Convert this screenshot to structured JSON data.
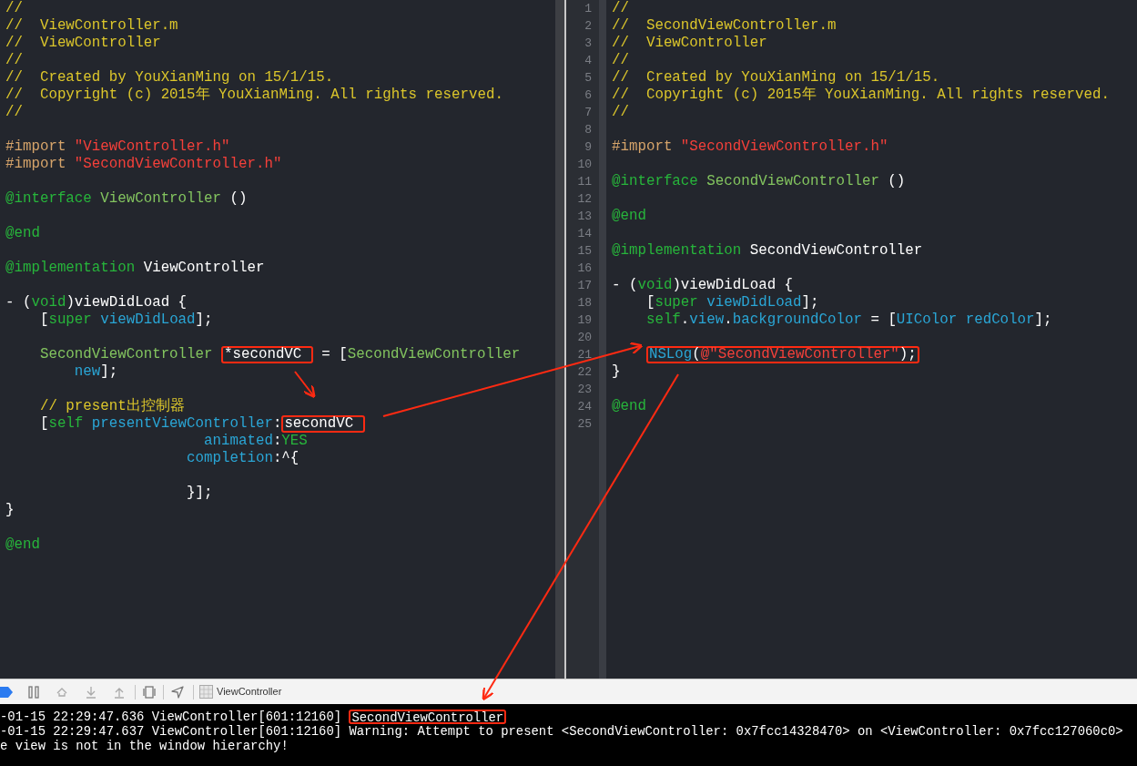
{
  "left_editor": {
    "lines": [
      {
        "kind": "code",
        "tokens": [
          {
            "kind": "comment",
            "text": "//"
          }
        ]
      },
      {
        "kind": "code",
        "tokens": [
          {
            "kind": "comment",
            "text": "//  ViewController.m"
          }
        ]
      },
      {
        "kind": "code",
        "tokens": [
          {
            "kind": "comment",
            "text": "//  ViewController"
          }
        ]
      },
      {
        "kind": "code",
        "tokens": [
          {
            "kind": "comment",
            "text": "//"
          }
        ]
      },
      {
        "kind": "code",
        "tokens": [
          {
            "kind": "comment",
            "text": "//  Created by YouXianMing on 15/1/15."
          }
        ]
      },
      {
        "kind": "code",
        "tokens": [
          {
            "kind": "comment",
            "text": "//  Copyright (c) 2015年 YouXianMing. All rights reserved."
          }
        ]
      },
      {
        "kind": "code",
        "tokens": [
          {
            "kind": "comment",
            "text": "//"
          }
        ]
      },
      {
        "kind": "blank"
      },
      {
        "kind": "code",
        "tokens": [
          {
            "kind": "preproc",
            "text": "#import "
          },
          {
            "kind": "string",
            "text": "\"ViewController.h\""
          }
        ]
      },
      {
        "kind": "code",
        "tokens": [
          {
            "kind": "preproc",
            "text": "#import "
          },
          {
            "kind": "string",
            "text": "\"SecondViewController.h\""
          }
        ]
      },
      {
        "kind": "blank"
      },
      {
        "kind": "code",
        "tokens": [
          {
            "kind": "keyword",
            "text": "@interface "
          },
          {
            "kind": "class",
            "text": "ViewController"
          },
          {
            "kind": "plain",
            "text": " ()"
          }
        ]
      },
      {
        "kind": "blank"
      },
      {
        "kind": "code",
        "tokens": [
          {
            "kind": "keyword",
            "text": "@end"
          }
        ]
      },
      {
        "kind": "blank"
      },
      {
        "kind": "code",
        "tokens": [
          {
            "kind": "keyword",
            "text": "@implementation "
          },
          {
            "kind": "plain",
            "text": "ViewController"
          }
        ]
      },
      {
        "kind": "blank"
      },
      {
        "kind": "code",
        "tokens": [
          {
            "kind": "plain",
            "text": "- ("
          },
          {
            "kind": "keyword",
            "text": "void"
          },
          {
            "kind": "plain",
            "text": ")viewDidLoad {"
          }
        ]
      },
      {
        "kind": "code",
        "tokens": [
          {
            "kind": "plain",
            "text": "    ["
          },
          {
            "kind": "keyword",
            "text": "super"
          },
          {
            "kind": "method",
            "text": " viewDidLoad"
          },
          {
            "kind": "plain",
            "text": "];"
          }
        ]
      },
      {
        "kind": "blank"
      },
      {
        "kind": "code",
        "tokens": [
          {
            "kind": "class",
            "text": "    SecondViewController "
          },
          {
            "kind": "boxed",
            "tokens": [
              {
                "kind": "plain",
                "text": "*secondVC "
              }
            ]
          },
          {
            "kind": "plain",
            "text": " = ["
          },
          {
            "kind": "class",
            "text": "SecondViewController"
          }
        ]
      },
      {
        "kind": "code",
        "tokens": [
          {
            "kind": "method",
            "text": "        new"
          },
          {
            "kind": "plain",
            "text": "];"
          }
        ]
      },
      {
        "kind": "blank"
      },
      {
        "kind": "code",
        "tokens": [
          {
            "kind": "comment",
            "text": "    // present出控制器"
          }
        ]
      },
      {
        "kind": "code",
        "tokens": [
          {
            "kind": "plain",
            "text": "    ["
          },
          {
            "kind": "keyword",
            "text": "self"
          },
          {
            "kind": "method",
            "text": " presentViewController"
          },
          {
            "kind": "plain",
            "text": ":"
          },
          {
            "kind": "boxed",
            "tokens": [
              {
                "kind": "plain",
                "text": "secondVC "
              }
            ]
          }
        ]
      },
      {
        "kind": "code",
        "tokens": [
          {
            "kind": "method",
            "text": "                       animated"
          },
          {
            "kind": "plain",
            "text": ":"
          },
          {
            "kind": "keyword",
            "text": "YES"
          }
        ]
      },
      {
        "kind": "code",
        "tokens": [
          {
            "kind": "method",
            "text": "                     completion"
          },
          {
            "kind": "plain",
            "text": ":^{"
          }
        ]
      },
      {
        "kind": "blank"
      },
      {
        "kind": "code",
        "tokens": [
          {
            "kind": "plain",
            "text": "                     }];"
          }
        ]
      },
      {
        "kind": "code",
        "tokens": [
          {
            "kind": "plain",
            "text": "}"
          }
        ]
      },
      {
        "kind": "blank"
      },
      {
        "kind": "code",
        "tokens": [
          {
            "kind": "keyword",
            "text": "@end"
          }
        ]
      }
    ]
  },
  "right_editor": {
    "lines": [
      {
        "number": "1",
        "kind": "code",
        "tokens": [
          {
            "kind": "comment",
            "text": "//"
          }
        ]
      },
      {
        "number": "2",
        "kind": "code",
        "tokens": [
          {
            "kind": "comment",
            "text": "//  SecondViewController.m"
          }
        ]
      },
      {
        "number": "3",
        "kind": "code",
        "tokens": [
          {
            "kind": "comment",
            "text": "//  ViewController"
          }
        ]
      },
      {
        "number": "4",
        "kind": "code",
        "tokens": [
          {
            "kind": "comment",
            "text": "//"
          }
        ]
      },
      {
        "number": "5",
        "kind": "code",
        "tokens": [
          {
            "kind": "comment",
            "text": "//  Created by YouXianMing on 15/1/15."
          }
        ]
      },
      {
        "number": "6",
        "kind": "code",
        "tokens": [
          {
            "kind": "comment",
            "text": "//  Copyright (c) 2015年 YouXianMing. All rights reserved."
          }
        ]
      },
      {
        "number": "7",
        "kind": "code",
        "tokens": [
          {
            "kind": "comment",
            "text": "//"
          }
        ]
      },
      {
        "number": "8",
        "kind": "blank"
      },
      {
        "number": "9",
        "kind": "code",
        "tokens": [
          {
            "kind": "preproc",
            "text": "#import "
          },
          {
            "kind": "string",
            "text": "\"SecondViewController.h\""
          }
        ]
      },
      {
        "number": "10",
        "kind": "blank"
      },
      {
        "number": "11",
        "kind": "code",
        "tokens": [
          {
            "kind": "keyword",
            "text": "@interface "
          },
          {
            "kind": "class",
            "text": "SecondViewController"
          },
          {
            "kind": "plain",
            "text": " ()"
          }
        ]
      },
      {
        "number": "12",
        "kind": "blank"
      },
      {
        "number": "13",
        "kind": "code",
        "tokens": [
          {
            "kind": "keyword",
            "text": "@end"
          }
        ]
      },
      {
        "number": "14",
        "kind": "blank"
      },
      {
        "number": "15",
        "kind": "code",
        "tokens": [
          {
            "kind": "keyword",
            "text": "@implementation "
          },
          {
            "kind": "plain",
            "text": "SecondViewController"
          }
        ]
      },
      {
        "number": "16",
        "kind": "blank"
      },
      {
        "number": "17",
        "kind": "code",
        "tokens": [
          {
            "kind": "plain",
            "text": "- ("
          },
          {
            "kind": "keyword",
            "text": "void"
          },
          {
            "kind": "plain",
            "text": ")viewDidLoad {"
          }
        ]
      },
      {
        "number": "18",
        "kind": "code",
        "tokens": [
          {
            "kind": "plain",
            "text": "    ["
          },
          {
            "kind": "keyword",
            "text": "super"
          },
          {
            "kind": "method",
            "text": " viewDidLoad"
          },
          {
            "kind": "plain",
            "text": "];"
          }
        ]
      },
      {
        "number": "19",
        "kind": "code",
        "tokens": [
          {
            "kind": "keyword",
            "text": "    self"
          },
          {
            "kind": "plain",
            "text": "."
          },
          {
            "kind": "method",
            "text": "view"
          },
          {
            "kind": "plain",
            "text": "."
          },
          {
            "kind": "method",
            "text": "backgroundColor"
          },
          {
            "kind": "plain",
            "text": " = ["
          },
          {
            "kind": "method",
            "text": "UIColor redColor"
          },
          {
            "kind": "plain",
            "text": "];"
          }
        ]
      },
      {
        "number": "20",
        "kind": "blank"
      },
      {
        "number": "21",
        "kind": "indented",
        "tokens": [
          {
            "kind": "boxed",
            "tokens": [
              {
                "kind": "method",
                "text": "NSLog"
              },
              {
                "kind": "plain",
                "text": "("
              },
              {
                "kind": "string",
                "text": "@\"SecondViewController\""
              },
              {
                "kind": "plain",
                "text": ");"
              }
            ]
          }
        ]
      },
      {
        "number": "22",
        "kind": "code",
        "tokens": [
          {
            "kind": "plain",
            "text": "}"
          }
        ]
      },
      {
        "number": "23",
        "kind": "blank"
      },
      {
        "number": "24",
        "kind": "code",
        "tokens": [
          {
            "kind": "keyword",
            "text": "@end"
          }
        ]
      },
      {
        "number": "25",
        "kind": "blank"
      }
    ]
  },
  "debug_bar": {
    "target": "ViewController"
  },
  "console": {
    "lines": [
      {
        "kind": "code",
        "tokens": [
          {
            "kind": "plain",
            "text": "-01-15 22:29:47.636 ViewController[601:12160] "
          },
          {
            "kind": "boxed",
            "tokens": [
              {
                "kind": "plain",
                "text": "SecondViewController"
              }
            ]
          }
        ]
      },
      {
        "kind": "code",
        "tokens": [
          {
            "kind": "plain",
            "text": "-01-15 22:29:47.637 ViewController[601:12160] Warning: Attempt to present <SecondViewController: 0x7fcc14328470> on <ViewController: 0x7fcc127060c0>"
          }
        ]
      },
      {
        "kind": "code",
        "tokens": [
          {
            "kind": "plain",
            "text": "e view is not in the window hierarchy!"
          }
        ]
      }
    ]
  }
}
